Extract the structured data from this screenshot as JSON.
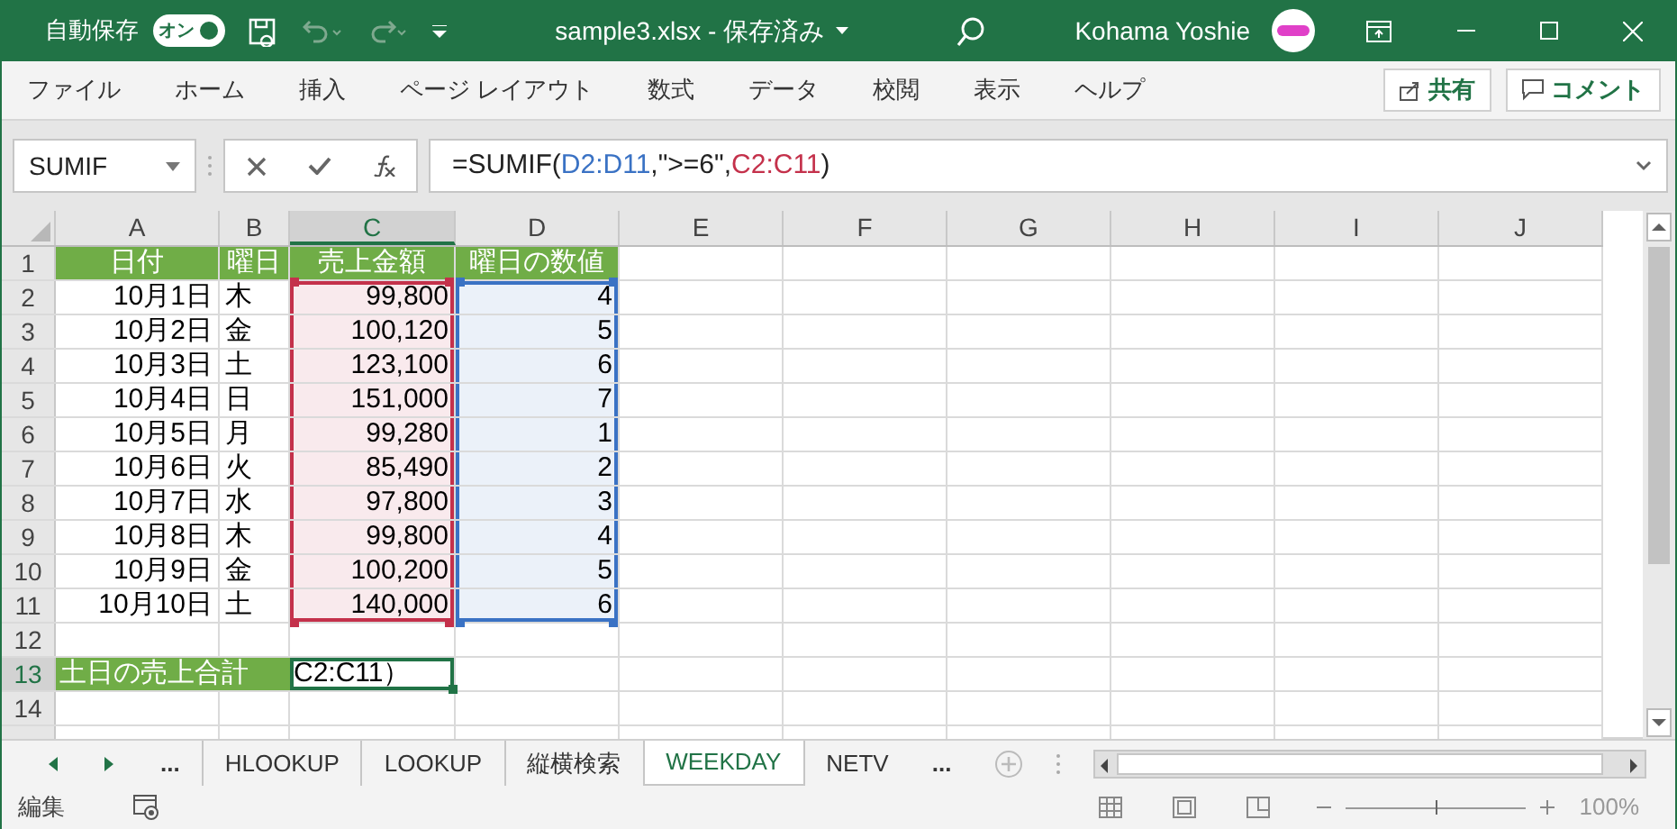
{
  "title_bar": {
    "autosave_label": "自動保存",
    "autosave_toggle": {
      "text": "オン",
      "on": true
    },
    "document_title": "sample3.xlsx - 保存済み",
    "user_name": "Kohama Yoshie"
  },
  "ribbon_tabs": [
    "ファイル",
    "ホーム",
    "挿入",
    "ページ レイアウト",
    "数式",
    "データ",
    "校閲",
    "表示",
    "ヘルプ"
  ],
  "ribbon_buttons": [
    {
      "kind": "share",
      "label": "共有"
    },
    {
      "kind": "comment",
      "label": "コメント"
    }
  ],
  "name_box": "SUMIF",
  "formula": [
    {
      "text": "=SUMIF("
    },
    {
      "text": "D2:D11",
      "color": "#3a72c4"
    },
    {
      "text": ",\">=6\","
    },
    {
      "text": "C2:C11",
      "color": "#c4314b"
    },
    {
      "text": ")"
    }
  ],
  "columns": [
    {
      "label": "A",
      "selected": false
    },
    {
      "label": "B",
      "selected": false
    },
    {
      "label": "C",
      "selected": true
    },
    {
      "label": "D",
      "selected": false
    },
    {
      "label": "E",
      "selected": false
    },
    {
      "label": "F",
      "selected": false
    },
    {
      "label": "G",
      "selected": false
    },
    {
      "label": "H",
      "selected": false
    },
    {
      "label": "I",
      "selected": false
    },
    {
      "label": "J",
      "selected": false
    }
  ],
  "rows": [
    {
      "label": "1",
      "selected": false,
      "cells": [
        {
          "kind": "header",
          "text": "日付"
        },
        {
          "kind": "header",
          "text": "曜日"
        },
        {
          "kind": "header",
          "text": "売上金額"
        },
        {
          "kind": "header",
          "text": "曜日の数値"
        }
      ]
    },
    {
      "label": "2",
      "selected": false,
      "cells": [
        {
          "kind": "value",
          "text": "10月1日"
        },
        {
          "kind": "text",
          "text": "木"
        },
        {
          "kind": "value",
          "text": "99,800",
          "color": "#c4314b"
        },
        {
          "kind": "value",
          "text": "4",
          "color": "#3a72c4"
        }
      ]
    },
    {
      "label": "3",
      "selected": false,
      "cells": [
        {
          "kind": "value",
          "text": "10月2日"
        },
        {
          "kind": "text",
          "text": "金"
        },
        {
          "kind": "value",
          "text": "100,120",
          "color": "#c4314b"
        },
        {
          "kind": "value",
          "text": "5",
          "color": "#3a72c4"
        }
      ]
    },
    {
      "label": "4",
      "selected": false,
      "cells": [
        {
          "kind": "value",
          "text": "10月3日"
        },
        {
          "kind": "text",
          "text": "土"
        },
        {
          "kind": "value",
          "text": "123,100",
          "color": "#c4314b"
        },
        {
          "kind": "value",
          "text": "6",
          "color": "#3a72c4"
        }
      ]
    },
    {
      "label": "5",
      "selected": false,
      "cells": [
        {
          "kind": "value",
          "text": "10月4日"
        },
        {
          "kind": "text",
          "text": "日"
        },
        {
          "kind": "value",
          "text": "151,000",
          "color": "#c4314b"
        },
        {
          "kind": "value",
          "text": "7",
          "color": "#3a72c4"
        }
      ]
    },
    {
      "label": "6",
      "selected": false,
      "cells": [
        {
          "kind": "value",
          "text": "10月5日"
        },
        {
          "kind": "text",
          "text": "月"
        },
        {
          "kind": "value",
          "text": "99,280",
          "color": "#c4314b"
        },
        {
          "kind": "value",
          "text": "1",
          "color": "#3a72c4"
        }
      ]
    },
    {
      "label": "7",
      "selected": false,
      "cells": [
        {
          "kind": "value",
          "text": "10月6日"
        },
        {
          "kind": "text",
          "text": "火"
        },
        {
          "kind": "value",
          "text": "85,490",
          "color": "#c4314b"
        },
        {
          "kind": "value",
          "text": "2",
          "color": "#3a72c4"
        }
      ]
    },
    {
      "label": "8",
      "selected": false,
      "cells": [
        {
          "kind": "value",
          "text": "10月7日"
        },
        {
          "kind": "text",
          "text": "水"
        },
        {
          "kind": "value",
          "text": "97,800",
          "color": "#c4314b"
        },
        {
          "kind": "value",
          "text": "3",
          "color": "#3a72c4"
        }
      ]
    },
    {
      "label": "9",
      "selected": false,
      "cells": [
        {
          "kind": "value",
          "text": "10月8日"
        },
        {
          "kind": "text",
          "text": "木"
        },
        {
          "kind": "value",
          "text": "99,800",
          "color": "#c4314b"
        },
        {
          "kind": "value",
          "text": "4",
          "color": "#3a72c4"
        }
      ]
    },
    {
      "label": "10",
      "selected": false,
      "cells": [
        {
          "kind": "value",
          "text": "10月9日"
        },
        {
          "kind": "text",
          "text": "金"
        },
        {
          "kind": "value",
          "text": "100,200",
          "color": "#c4314b"
        },
        {
          "kind": "value",
          "text": "5",
          "color": "#3a72c4"
        }
      ]
    },
    {
      "label": "11",
      "selected": false,
      "cells": [
        {
          "kind": "value",
          "text": "10月10日"
        },
        {
          "kind": "text",
          "text": "土"
        },
        {
          "kind": "value",
          "text": "140,000",
          "color": "#c4314b"
        },
        {
          "kind": "value",
          "text": "6",
          "color": "#3a72c4"
        }
      ]
    },
    {
      "label": "12",
      "selected": false
    },
    {
      "label": "13",
      "selected": true,
      "cells": [
        {
          "kind": "label",
          "text": "土日の売上合計"
        },
        {
          "kind": "label"
        },
        {
          "kind": "edit",
          "text": "C2:C11）",
          "active": true
        }
      ]
    },
    {
      "label": "14",
      "selected": false
    }
  ],
  "sheet_tabs": [
    {
      "label": "...",
      "selected": false
    },
    {
      "label": "HLOOKUP",
      "selected": false
    },
    {
      "label": "LOOKUP",
      "selected": false
    },
    {
      "label": "縦横検索",
      "selected": false
    },
    {
      "label": "WEEKDAY",
      "selected": true
    },
    {
      "label": "NETV",
      "selected": false
    },
    {
      "label": "...",
      "selected": false
    }
  ],
  "status_bar": {
    "mode": "編集",
    "zoom": {
      "level": 0.5,
      "reading": "100%"
    }
  }
}
